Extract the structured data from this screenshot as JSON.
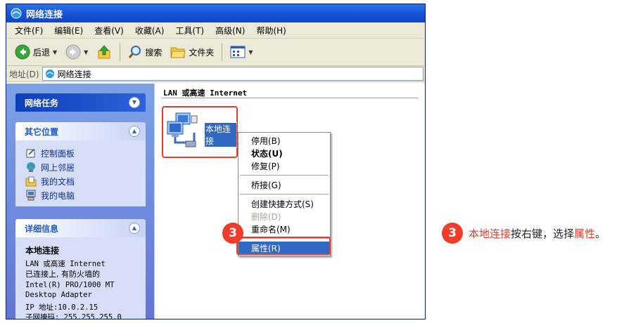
{
  "window": {
    "title": "网络连接"
  },
  "menu": [
    "文件(F)",
    "编辑(E)",
    "查看(V)",
    "收藏(A)",
    "工具(T)",
    "高级(N)",
    "帮助(H)"
  ],
  "toolbar": {
    "back": "后退",
    "search": "搜索",
    "folders": "文件夹"
  },
  "address": {
    "label": "地址(D)",
    "value": "网络连接"
  },
  "taskpane": {
    "network_tasks": "网络任务",
    "other_places": {
      "title": "其它位置",
      "links": [
        "控制面板",
        "网上邻居",
        "我的文档",
        "我的电脑"
      ]
    },
    "details": {
      "title": "详细信息",
      "name": "本地连接",
      "lines": [
        "LAN 或高速 Internet",
        "已连接上, 有防火墙的",
        "Intel(R) PRO/1000 MT",
        "Desktop Adapter",
        "IP 地址:10.0.2.15",
        "子网掩码: 255.255.255.0"
      ]
    }
  },
  "main": {
    "section_header": "LAN 或高速 Internet",
    "connection_label": "本地连接"
  },
  "context_menu": {
    "group1": [
      "停用(B)",
      "状态(U)",
      "修复(P)"
    ],
    "bridge": "桥接(G)",
    "group3": [
      "创建快捷方式(S)",
      "删除(D)",
      "重命名(M)"
    ],
    "properties": "属性(R)"
  },
  "step": {
    "number": "3",
    "caption_hl1": "本地连接",
    "caption_mid": "按右键，选择",
    "caption_hl2": "属性",
    "caption_end": "。"
  },
  "colors": {
    "accent_red": "#e8392a",
    "selection_blue": "#316ac5",
    "title_blue": "#1452d6"
  },
  "icons": [
    "network-connections-icon",
    "back-arrow-icon",
    "forward-arrow-icon",
    "up-folder-icon",
    "search-icon",
    "folder-icon",
    "views-icon",
    "control-panel-icon",
    "network-places-icon",
    "my-documents-icon",
    "my-computer-icon",
    "lan-connection-icon"
  ]
}
